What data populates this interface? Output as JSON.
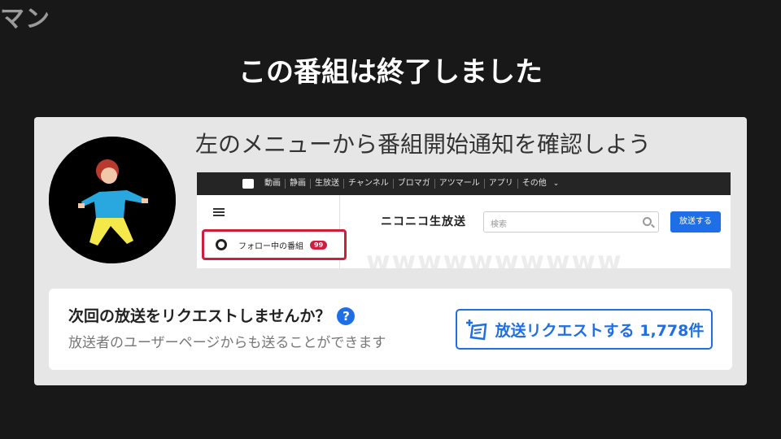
{
  "header": {
    "corner_text": "マン",
    "title": "この番組は終了しました"
  },
  "card": {
    "hint": "左のメニューから番組開始通知を確認しよう",
    "preview": {
      "nav_items": [
        "動画",
        "静画",
        "生放送",
        "チャンネル",
        "ブロマガ",
        "アツマール",
        "アプリ",
        "その他"
      ],
      "follow_label": "フォロー中の番組",
      "follow_count": "99",
      "logo": "ニコニコ生放送",
      "search_placeholder": "検索",
      "broadcast_button": "放送する",
      "watermark": "wwwwwwwwww"
    },
    "request": {
      "title": "次回の放送をリクエストしませんか？",
      "subtitle": "放送者のユーザーページからも送ることができます",
      "button_label": "放送リクエストする 1,778件"
    }
  },
  "colors": {
    "background": "#181818",
    "card": "#e6e6e6",
    "accent_blue": "#1e6fe6",
    "highlight_red": "#cc1f3c"
  }
}
